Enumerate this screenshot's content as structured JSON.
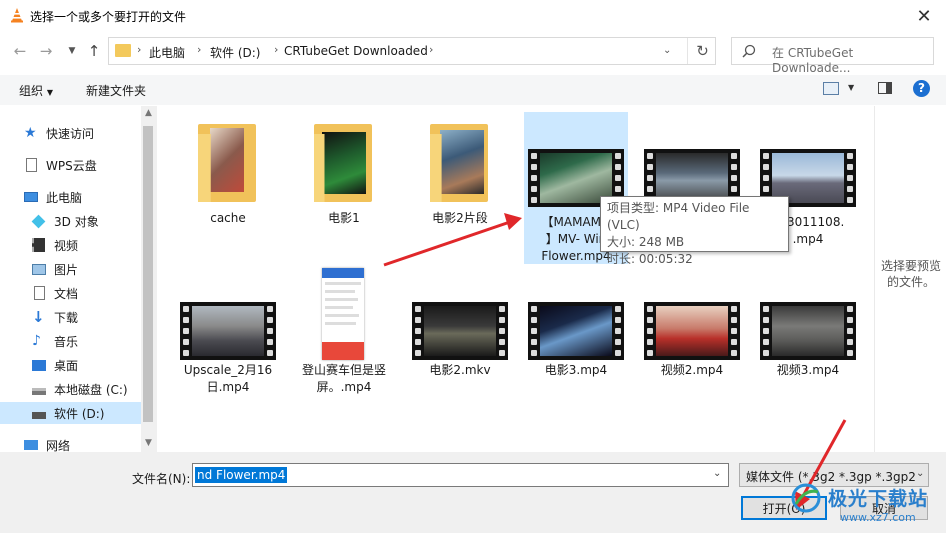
{
  "window": {
    "title": "选择一个或多个要打开的文件"
  },
  "address": {
    "crumbs": [
      "此电脑",
      "软件 (D:)",
      "CRTubeGet Downloaded"
    ]
  },
  "search": {
    "placeholder": "在 CRTubeGet Downloade..."
  },
  "toolbar": {
    "organize": "组织",
    "new_folder": "新建文件夹"
  },
  "sidebar": {
    "items": [
      {
        "label": "快速访问",
        "icon": "star-icon"
      },
      {
        "label": "WPS云盘",
        "icon": "cloud-doc-icon"
      },
      {
        "label": "此电脑",
        "icon": "computer-icon"
      },
      {
        "label": "3D 对象",
        "icon": "cube-icon"
      },
      {
        "label": "视频",
        "icon": "video-icon"
      },
      {
        "label": "图片",
        "icon": "picture-icon"
      },
      {
        "label": "文档",
        "icon": "document-icon"
      },
      {
        "label": "下载",
        "icon": "download-icon"
      },
      {
        "label": "音乐",
        "icon": "music-icon"
      },
      {
        "label": "桌面",
        "icon": "desktop-icon"
      },
      {
        "label": "本地磁盘 (C:)",
        "icon": "drive-icon"
      },
      {
        "label": "软件 (D:)",
        "icon": "drive-icon"
      },
      {
        "label": "网络",
        "icon": "network-icon"
      }
    ]
  },
  "files": [
    {
      "name": "cache",
      "kind": "folder"
    },
    {
      "name": "电影1",
      "kind": "folder"
    },
    {
      "name": "电影2片段",
      "kind": "folder"
    },
    {
      "name": "【MAMAMO\n】MV- Win\nFlower.mp4",
      "kind": "video",
      "selected": true
    },
    {
      "name": "",
      "kind": "video"
    },
    {
      "name": "303011108.\n.mp4",
      "kind": "video"
    },
    {
      "name": "Upscale_2月16\n日.mp4",
      "kind": "video"
    },
    {
      "name": "登山赛车但是竖\n屏。.mp4",
      "kind": "image"
    },
    {
      "name": "电影2.mkv",
      "kind": "video"
    },
    {
      "name": "电影3.mp4",
      "kind": "video"
    },
    {
      "name": "视频2.mp4",
      "kind": "video"
    },
    {
      "name": "视频3.mp4",
      "kind": "video"
    }
  ],
  "tooltip": {
    "type": "项目类型: MP4 Video File (VLC)",
    "size": "大小: 248 MB",
    "duration": "时长: 00:05:32"
  },
  "preview_text": "选择要预览\n的文件。",
  "bottom": {
    "filename_label": "文件名(N):",
    "filename_value": "nd Flower.mp4",
    "filetype_value": "媒体文件 (*.3g2 *.3gp *.3gp2",
    "open_label": "打开(O)",
    "cancel_label": "取消"
  },
  "watermark": {
    "text": "极光下载站",
    "url": "www.xz7.com"
  },
  "colors": {
    "accent": "#0078d7",
    "arrow": "#e0272a",
    "folder": "#f3c95c",
    "selection": "#cce8ff"
  }
}
